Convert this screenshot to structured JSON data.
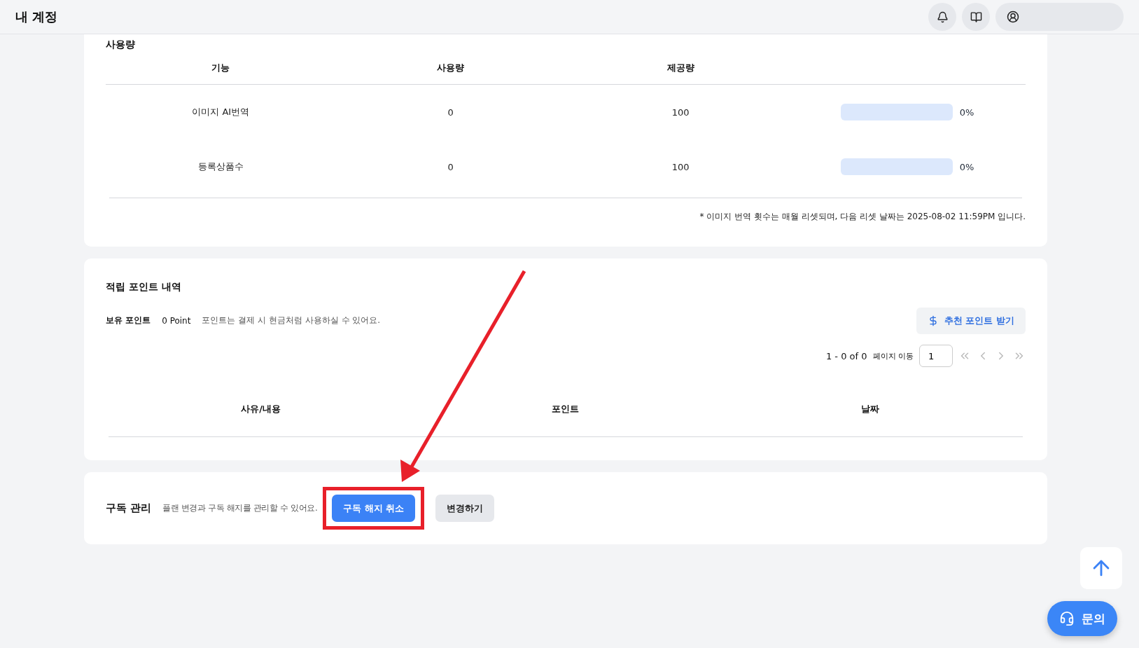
{
  "header": {
    "title": "내 계정"
  },
  "usage": {
    "title": "사용량",
    "columns": [
      "기능",
      "사용량",
      "제공량"
    ],
    "rows": [
      {
        "feature": "이미지 AI번역",
        "used": "0",
        "provided": "100",
        "level": 0,
        "percent": "0%"
      },
      {
        "feature": "등록상품수",
        "used": "0",
        "provided": "100",
        "level": 0,
        "percent": "0%"
      }
    ],
    "note": "* 이미지 번역 횟수는 매월 리셋되며, 다음 리셋 날짜는 2025-08-02 11:59PM 입니다."
  },
  "points": {
    "title": "적립 포인트 내역",
    "balance_label": "보유 포인트",
    "balance": "0 Point",
    "description": "포인트는 결제 시 현금처럼 사용하실 수 있어요.",
    "referral_button": "추천 포인트 받기",
    "range": "1 - 0 of 0",
    "page_jump_label": "페이지 이동",
    "page_value": "1",
    "columns": [
      "사유/내용",
      "포인트",
      "날짜"
    ]
  },
  "subscription": {
    "title": "구독 관리",
    "description": "플랜 변경과 구독 해지를 관리할 수 있어요.",
    "buttons": [
      {
        "label": "구독 해지 취소",
        "kind": "primary"
      },
      {
        "label": "변경하기",
        "kind": "secondary"
      }
    ]
  },
  "floating": {
    "contact_label": "문의"
  }
}
